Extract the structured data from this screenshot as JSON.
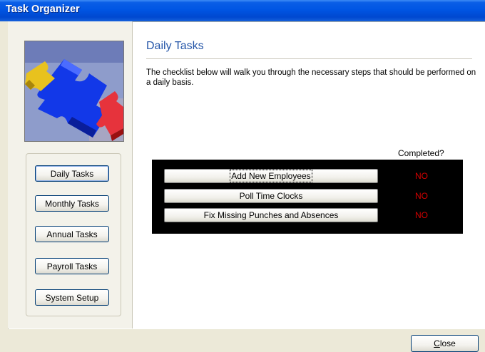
{
  "window": {
    "title": "Task Organizer"
  },
  "nav": {
    "items": [
      {
        "label": "Daily Tasks",
        "active": true
      },
      {
        "label": "Monthly Tasks",
        "active": false
      },
      {
        "label": "Annual Tasks",
        "active": false
      },
      {
        "label": "Payroll Tasks",
        "active": false
      },
      {
        "label": "System Setup",
        "active": false
      }
    ]
  },
  "main": {
    "section_title": "Daily Tasks",
    "description": "The checklist below will walk you through the necessary steps that should be performed on a daily basis.",
    "completed_header": "Completed?",
    "tasks": [
      {
        "label": "Add New Employees",
        "completed": "NO"
      },
      {
        "label": "Poll Time Clocks",
        "completed": "NO"
      },
      {
        "label": "Fix Missing Punches and Absences",
        "completed": "NO"
      }
    ]
  },
  "footer": {
    "close_label_first": "C",
    "close_label_rest": "lose"
  },
  "colors": {
    "title_bar": "#0055e3",
    "section_title": "#2455a8",
    "status_no": "#d30000",
    "checklist_bg": "#000000"
  },
  "icons": {
    "logo": "puzzle-pieces-logo"
  }
}
